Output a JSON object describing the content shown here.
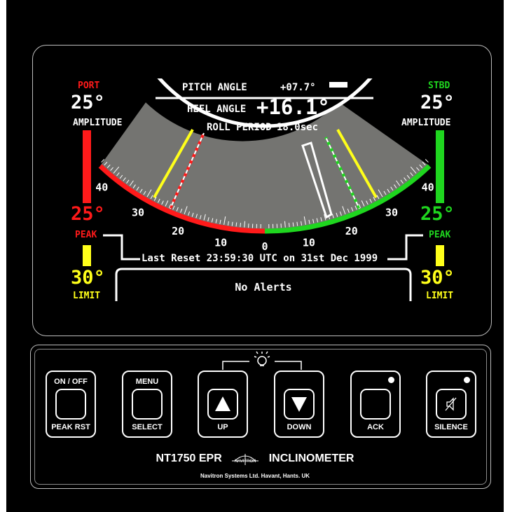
{
  "screen": {
    "pitch_label": "PITCH ANGLE",
    "pitch_value": "+07.7°",
    "heel_label": "HEEL ANGLE",
    "heel_value": "+16.1°",
    "roll_label": "ROLL PERIOD",
    "roll_value": "18.0sec",
    "port": {
      "title": "PORT",
      "amplitude": "25°",
      "amplitude_label": "AMPLITUDE",
      "peak": "25°",
      "peak_label": "PEAK",
      "limit": "30°",
      "limit_label": "LIMIT"
    },
    "stbd": {
      "title": "STBD",
      "amplitude": "25°",
      "amplitude_label": "AMPLITUDE",
      "peak": "25°",
      "peak_label": "PEAK",
      "limit": "30°",
      "limit_label": "LIMIT"
    },
    "scale_ticks": [
      "40",
      "30",
      "20",
      "10",
      "0",
      "10",
      "20",
      "30",
      "40"
    ],
    "last_reset": "Last Reset 23:59:30 UTC on 31st Dec 1999",
    "alerts": "No Alerts",
    "colors": {
      "port": "#ff1a1a",
      "stbd": "#1fd61f",
      "limit": "#ffff1a",
      "sector": "#747471"
    }
  },
  "panel": {
    "buttons": [
      {
        "top": "ON / OFF",
        "bottom": "PEAK RST",
        "icon": "blank-key"
      },
      {
        "top": "MENU",
        "bottom": "SELECT",
        "icon": "blank-key"
      },
      {
        "top": "",
        "bottom": "UP",
        "icon": "up-arrow-icon"
      },
      {
        "top": "",
        "bottom": "DOWN",
        "icon": "down-arrow-icon"
      },
      {
        "top": "",
        "bottom": "ACK",
        "icon": "blank-key"
      },
      {
        "top": "",
        "bottom": "SILENCE",
        "icon": "speaker-muted-icon"
      }
    ],
    "brightness_icon": "light-bulb-icon",
    "model": "NT1750 EPR",
    "logo_text": "NAVITRON",
    "product": "INCLINOMETER",
    "maker": "Navitron Systems Ltd. Havant, Hants. UK"
  }
}
